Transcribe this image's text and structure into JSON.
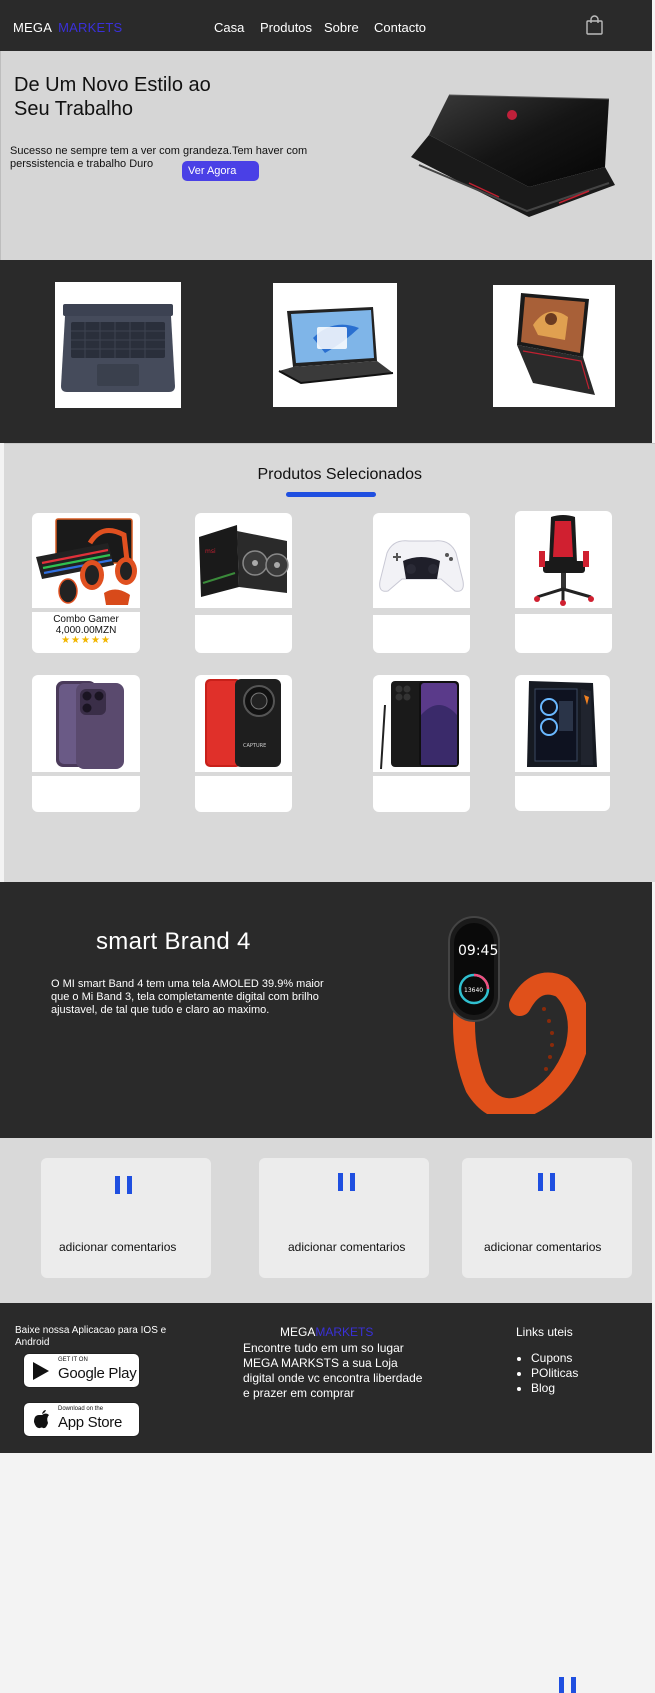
{
  "header": {
    "logo_main": "MEGA",
    "logo_accent": "MARKETS",
    "nav": [
      "Casa",
      "Produtos",
      "Sobre",
      "Contacto"
    ],
    "cart_icon": "shopping-bag-icon"
  },
  "hero": {
    "title": "De Um Novo Estilo ao Seu Trabalho",
    "description": "Sucesso ne sempre tem a ver com grandeza.Tem haver com perssistencia e trabalho Duro",
    "cta": "Ver Agora",
    "image": "gaming-laptop-image"
  },
  "strip": {
    "images": [
      "laptop-gray-image",
      "laptop-windows-image",
      "laptop-gaming-image"
    ]
  },
  "selected": {
    "title": "Produtos Selecionados",
    "accent_color": "#1f4fe0",
    "products": [
      {
        "image": "gaming-kit-image",
        "name": "Combo Gamer",
        "price": "4,000.00MZN",
        "stars": "★★★★★"
      },
      {
        "image": "graphics-card-image",
        "name": "",
        "price": "",
        "stars": ""
      },
      {
        "image": "game-controller-image",
        "name": "",
        "price": "",
        "stars": ""
      },
      {
        "image": "gaming-chair-image",
        "name": "",
        "price": "",
        "stars": ""
      },
      {
        "image": "iphone-image",
        "name": "",
        "price": "",
        "stars": ""
      },
      {
        "image": "xiaomi-phone-image",
        "name": "",
        "price": "",
        "stars": ""
      },
      {
        "image": "galaxy-s23-ultra-image",
        "name": "",
        "price": "",
        "stars": ""
      },
      {
        "image": "gaming-pc-image",
        "name": "",
        "price": "",
        "stars": ""
      }
    ]
  },
  "watch": {
    "title": "smart Brand 4",
    "description": "O MI smart Band 4 tem uma tela AMOLED 39.9% maior que o Mi Band 3, tela completamente digital com brilho ajustavel, de tal que tudo e claro ao maximo.",
    "image": "smart-band-image",
    "screen_time": "09:45",
    "screen_steps": "13640"
  },
  "comments": {
    "items": [
      {
        "icon": "quote-icon",
        "text": "adicionar comentarios"
      },
      {
        "icon": "quote-icon",
        "text": "adicionar comentarios"
      },
      {
        "icon": "quote-icon",
        "text": "adicionar comentarios"
      }
    ]
  },
  "footer": {
    "download_text": "Baixe nossa Aplicacao para IOS e Android",
    "google_play_sub": "GET IT ON",
    "google_play_main": "Google Play",
    "app_store_sub": "Download on the",
    "app_store_main": "App Store",
    "logo_main": "MEGA",
    "logo_accent": "MARKETS",
    "description": "Encontre tudo em um so lugar MEGA MARKSTS a sua Loja digital onde vc encontra liberdade e prazer em comprar",
    "links_title": "Links uteis",
    "links": [
      "Cupons",
      "POliticas",
      "Blog"
    ]
  },
  "colors": {
    "dark": "#2a2a2a",
    "light": "#d9d9d9",
    "button": "#4a40e6",
    "accent_blue": "#1f4fe0",
    "logo_accent": "#3a30d8",
    "stars": "#f2b600"
  }
}
